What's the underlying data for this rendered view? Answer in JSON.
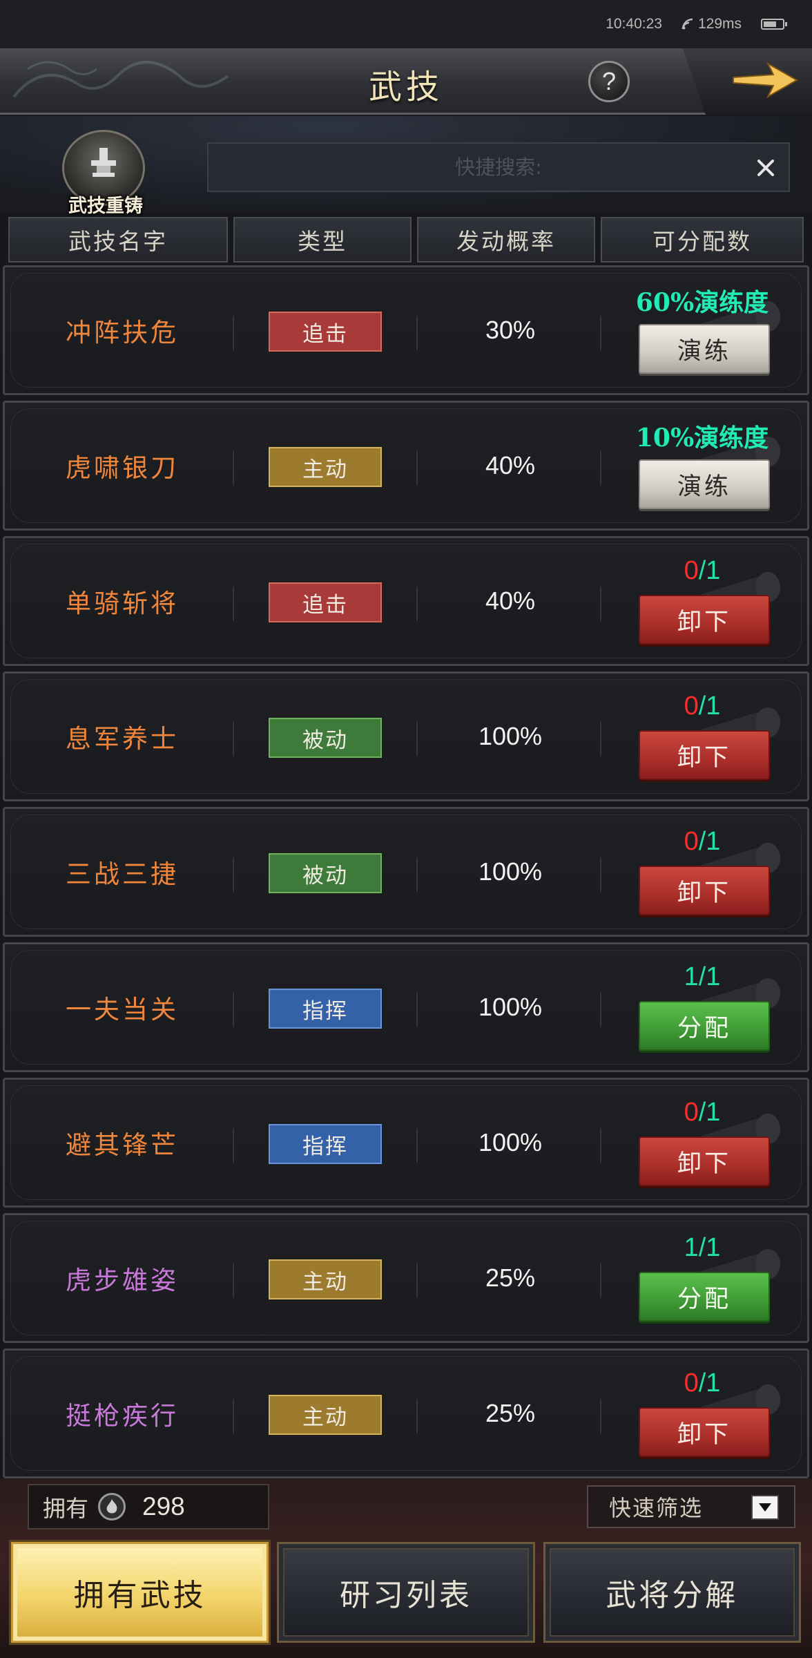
{
  "status": {
    "time": "10:40:23",
    "ping": "129ms",
    "battery_level": 0.7
  },
  "title": "武技",
  "help_label": "?",
  "recast_label": "武技重铸",
  "search": {
    "placeholder": "快捷搜索:",
    "value": ""
  },
  "headers": [
    "武技名字",
    "类型",
    "发动概率",
    "可分配数"
  ],
  "colors": {
    "name_orange": "#f0863c",
    "name_purple": "#c878d8",
    "type_pursuit": "#a83a3a",
    "type_active": "#9c7a2e",
    "type_passive": "#3e7a3a",
    "type_command": "#3561a8"
  },
  "skills": [
    {
      "name": "冲阵扶危",
      "name_color": "orange",
      "type": "追击",
      "type_kind": "pursuit",
      "rate": "30%",
      "progress": "60%演练度",
      "action": "演练",
      "action_kind": "train"
    },
    {
      "name": "虎啸银刀",
      "name_color": "orange",
      "type": "主动",
      "type_kind": "active",
      "rate": "40%",
      "progress": "10%演练度",
      "action": "演练",
      "action_kind": "train"
    },
    {
      "name": "单骑斩将",
      "name_color": "orange",
      "type": "追击",
      "type_kind": "pursuit",
      "rate": "40%",
      "count_current": "0",
      "count_total": "1",
      "count_state": "red",
      "action": "卸下",
      "action_kind": "unload"
    },
    {
      "name": "息军养士",
      "name_color": "orange",
      "type": "被动",
      "type_kind": "passive",
      "rate": "100%",
      "count_current": "0",
      "count_total": "1",
      "count_state": "red",
      "action": "卸下",
      "action_kind": "unload"
    },
    {
      "name": "三战三捷",
      "name_color": "orange",
      "type": "被动",
      "type_kind": "passive",
      "rate": "100%",
      "count_current": "0",
      "count_total": "1",
      "count_state": "red",
      "action": "卸下",
      "action_kind": "unload"
    },
    {
      "name": "一夫当关",
      "name_color": "orange",
      "type": "指挥",
      "type_kind": "command",
      "rate": "100%",
      "count_current": "1",
      "count_total": "1",
      "count_state": "green",
      "action": "分配",
      "action_kind": "assign"
    },
    {
      "name": "避其锋芒",
      "name_color": "orange",
      "type": "指挥",
      "type_kind": "command",
      "rate": "100%",
      "count_current": "0",
      "count_total": "1",
      "count_state": "red",
      "action": "卸下",
      "action_kind": "unload"
    },
    {
      "name": "虎步雄姿",
      "name_color": "purple",
      "type": "主动",
      "type_kind": "active",
      "rate": "25%",
      "count_current": "1",
      "count_total": "1",
      "count_state": "green",
      "action": "分配",
      "action_kind": "assign"
    },
    {
      "name": "挺枪疾行",
      "name_color": "purple",
      "type": "主动",
      "type_kind": "active",
      "rate": "25%",
      "count_current": "0",
      "count_total": "1",
      "count_state": "red",
      "action": "卸下",
      "action_kind": "unload"
    }
  ],
  "owned": {
    "label": "拥有",
    "value": "298"
  },
  "filter_label": "快速筛选",
  "tabs": [
    {
      "label": "拥有武技",
      "active": true
    },
    {
      "label": "研习列表",
      "active": false
    },
    {
      "label": "武将分解",
      "active": false
    }
  ]
}
